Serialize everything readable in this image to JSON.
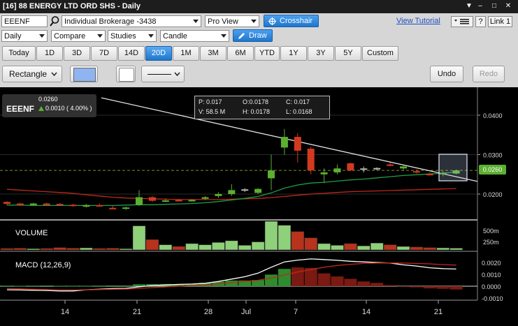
{
  "window": {
    "title": "[16] 88 ENERGY LTD ORD SHS - Daily",
    "controls": [
      "▼",
      "–",
      "□",
      "✕"
    ]
  },
  "toolbar": {
    "symbol": "EEENF",
    "account": "Individual Brokerage -3438",
    "view": "Pro View",
    "crosshair_label": "Crosshair",
    "view_tutorial": "View Tutorial",
    "help": "?",
    "link": "Link 1",
    "interval": "Daily",
    "compare": "Compare",
    "studies": "Studies",
    "chart_type": "Candle",
    "draw_label": "Draw"
  },
  "periods": [
    "Today",
    "1D",
    "3D",
    "7D",
    "14D",
    "20D",
    "1M",
    "3M",
    "6M",
    "YTD",
    "1Y",
    "3Y",
    "5Y",
    "Custom"
  ],
  "active_period": "20D",
  "drawing": {
    "shape": "Rectangle",
    "undo": "Undo",
    "redo": "Redo",
    "stroke_color": "#8fb4f0",
    "fill_color": "#ffffff"
  },
  "quote": {
    "symbol": "EEENF",
    "last": "0.0260",
    "change": "0.0010 ( 4.00% )"
  },
  "ohlc_box": {
    "p": "P: 0.017",
    "o": "O:0.0178",
    "c": "C: 0.017",
    "v": "V: 58.5 M",
    "h": "H: 0.0178",
    "l": "L: 0.0168"
  },
  "price_axis": {
    "ticks": [
      "0.0400",
      "0.0300",
      "0.0200"
    ],
    "current": "0.0260"
  },
  "volume": {
    "label": "VOLUME",
    "ticks": [
      "500m",
      "250m"
    ]
  },
  "macd": {
    "label": "MACD (12,26,9)",
    "ticks": [
      "0.0020",
      "0.0010",
      "0.0000",
      "-0.0010"
    ]
  },
  "x_axis": [
    "14",
    "21",
    "28",
    "Jul",
    "7",
    "14",
    "21"
  ],
  "colors": {
    "up": "#5cb030",
    "down": "#d23a1f",
    "volume_up": "#8fd07a",
    "volume_down": "#b8321c",
    "accent": "#1f76cc"
  },
  "chart_data": {
    "type": "candlestick",
    "candles": [
      {
        "o": 0.018,
        "h": 0.0182,
        "l": 0.0172,
        "c": 0.0175,
        "dir": "down",
        "vol": 25
      },
      {
        "o": 0.0176,
        "h": 0.0178,
        "l": 0.017,
        "c": 0.0172,
        "dir": "down",
        "vol": 30
      },
      {
        "o": 0.0172,
        "h": 0.0178,
        "l": 0.017,
        "c": 0.0176,
        "dir": "up",
        "vol": 20
      },
      {
        "o": 0.0176,
        "h": 0.0178,
        "l": 0.017,
        "c": 0.0172,
        "dir": "down",
        "vol": 25
      },
      {
        "o": 0.0175,
        "h": 0.0177,
        "l": 0.017,
        "c": 0.0173,
        "dir": "down",
        "vol": 40
      },
      {
        "o": 0.0173,
        "h": 0.0175,
        "l": 0.0168,
        "c": 0.017,
        "dir": "down",
        "vol": 30
      },
      {
        "o": 0.0168,
        "h": 0.0175,
        "l": 0.0166,
        "c": 0.0172,
        "dir": "up",
        "vol": 35
      },
      {
        "o": 0.0172,
        "h": 0.0176,
        "l": 0.0168,
        "c": 0.017,
        "dir": "down",
        "vol": 25
      },
      {
        "o": 0.0165,
        "h": 0.017,
        "l": 0.0162,
        "c": 0.0163,
        "dir": "down",
        "vol": 30
      },
      {
        "o": 0.0163,
        "h": 0.0168,
        "l": 0.016,
        "c": 0.0166,
        "dir": "up",
        "vol": 20
      },
      {
        "o": 0.0172,
        "h": 0.021,
        "l": 0.017,
        "c": 0.0192,
        "dir": "up",
        "vol": 420
      },
      {
        "o": 0.0192,
        "h": 0.0195,
        "l": 0.018,
        "c": 0.0183,
        "dir": "down",
        "vol": 180
      },
      {
        "o": 0.0182,
        "h": 0.0188,
        "l": 0.018,
        "c": 0.0184,
        "dir": "up",
        "vol": 90
      },
      {
        "o": 0.0185,
        "h": 0.0188,
        "l": 0.0181,
        "c": 0.0183,
        "dir": "down",
        "vol": 60
      },
      {
        "o": 0.0183,
        "h": 0.0187,
        "l": 0.0181,
        "c": 0.0185,
        "dir": "up",
        "vol": 110
      },
      {
        "o": 0.0188,
        "h": 0.0195,
        "l": 0.0185,
        "c": 0.0192,
        "dir": "up",
        "vol": 90
      },
      {
        "o": 0.0195,
        "h": 0.0205,
        "l": 0.019,
        "c": 0.02,
        "dir": "up",
        "vol": 130
      },
      {
        "o": 0.02,
        "h": 0.0225,
        "l": 0.0195,
        "c": 0.021,
        "dir": "up",
        "vol": 160
      },
      {
        "o": 0.021,
        "h": 0.0215,
        "l": 0.0205,
        "c": 0.0212,
        "dir": "neutral",
        "vol": 80
      },
      {
        "o": 0.0203,
        "h": 0.0215,
        "l": 0.02,
        "c": 0.0213,
        "dir": "up",
        "vol": 140
      },
      {
        "o": 0.026,
        "h": 0.03,
        "l": 0.021,
        "c": 0.024,
        "dir": "up",
        "vol": 500
      },
      {
        "o": 0.0318,
        "h": 0.0365,
        "l": 0.03,
        "c": 0.0345,
        "dir": "up",
        "vol": 430
      },
      {
        "o": 0.0345,
        "h": 0.0355,
        "l": 0.028,
        "c": 0.031,
        "dir": "down",
        "vol": 320
      },
      {
        "o": 0.0315,
        "h": 0.032,
        "l": 0.025,
        "c": 0.026,
        "dir": "down",
        "vol": 210
      },
      {
        "o": 0.0255,
        "h": 0.0265,
        "l": 0.0228,
        "c": 0.025,
        "dir": "up",
        "vol": 110
      },
      {
        "o": 0.0255,
        "h": 0.0275,
        "l": 0.025,
        "c": 0.0265,
        "dir": "up",
        "vol": 80
      },
      {
        "o": 0.0278,
        "h": 0.028,
        "l": 0.0258,
        "c": 0.026,
        "dir": "down",
        "vol": 110
      },
      {
        "o": 0.0262,
        "h": 0.027,
        "l": 0.0255,
        "c": 0.0265,
        "dir": "neutral",
        "vol": 70
      },
      {
        "o": 0.0266,
        "h": 0.0268,
        "l": 0.026,
        "c": 0.0264,
        "dir": "neutral",
        "vol": 120
      },
      {
        "o": 0.0275,
        "h": 0.028,
        "l": 0.027,
        "c": 0.0272,
        "dir": "down",
        "vol": 90
      },
      {
        "o": 0.0265,
        "h": 0.0272,
        "l": 0.026,
        "c": 0.027,
        "dir": "up",
        "vol": 60
      },
      {
        "o": 0.0258,
        "h": 0.0262,
        "l": 0.0252,
        "c": 0.0255,
        "dir": "down",
        "vol": 50
      },
      {
        "o": 0.0251,
        "h": 0.0255,
        "l": 0.0248,
        "c": 0.025,
        "dir": "down",
        "vol": 40
      },
      {
        "o": 0.025,
        "h": 0.0258,
        "l": 0.0245,
        "c": 0.0254,
        "dir": "up",
        "vol": 35
      },
      {
        "o": 0.0252,
        "h": 0.0262,
        "l": 0.025,
        "c": 0.026,
        "dir": "up",
        "vol": 30
      }
    ],
    "red_ma": [
      0.0212,
      0.021,
      0.0208,
      0.0206,
      0.0204,
      0.0202,
      0.0198,
      0.0195,
      0.0192,
      0.019,
      0.0189,
      0.0188,
      0.0187,
      0.0186,
      0.0186,
      0.0186,
      0.0186,
      0.0187,
      0.0188,
      0.0189,
      0.0191,
      0.0194,
      0.0197,
      0.02,
      0.0202,
      0.0204,
      0.0206,
      0.0207,
      0.0208,
      0.0209,
      0.021,
      0.0211,
      0.0212,
      0.0213,
      0.0214
    ],
    "green_ma": [
      0.0172,
      0.0172,
      0.0171,
      0.0171,
      0.0171,
      0.0171,
      0.0171,
      0.0171,
      0.0171,
      0.0172,
      0.0173,
      0.0173,
      0.0174,
      0.0175,
      0.0176,
      0.0178,
      0.0181,
      0.0185,
      0.0189,
      0.0194,
      0.0203,
      0.0215,
      0.0223,
      0.0228,
      0.023,
      0.0233,
      0.0236,
      0.0238,
      0.0241,
      0.0244,
      0.0247,
      0.0249,
      0.0251,
      0.0253,
      0.0256
    ],
    "trendline": {
      "start_price": 0.0444,
      "end_price": 0.0232
    },
    "macd_hist": [
      5e-05,
      4e-05,
      5e-05,
      6e-05,
      4e-05,
      2e-05,
      2e-05,
      1e-05,
      0.0,
      0.0,
      0.00016,
      0.00018,
      0.00019,
      0.00018,
      0.0002,
      0.00028,
      0.00038,
      0.00048,
      0.00048,
      0.00052,
      0.00098,
      0.00146,
      0.00158,
      0.00154,
      0.00108,
      0.00082,
      0.00062,
      0.0004,
      0.00028,
      0.0001,
      -2e-05,
      -0.0001,
      -0.00018,
      -0.00022,
      -0.00028
    ],
    "macd_line": [
      -0.0003,
      -0.00032,
      -0.00034,
      -0.00036,
      -0.0004,
      -0.0004,
      -0.0003,
      -0.00025,
      -0.0002,
      -0.00018,
      -5e-05,
      5e-05,
      0.0001,
      0.00015,
      0.00018,
      0.00025,
      0.0004,
      0.0006,
      0.0008,
      0.0011,
      0.0016,
      0.00205,
      0.0022,
      0.0023,
      0.00225,
      0.00218,
      0.0021,
      0.00205,
      0.002,
      0.00195,
      0.0018,
      0.0017,
      0.00155,
      0.00148,
      0.00145
    ],
    "signal_line": [
      -0.0002,
      -0.00022,
      -0.00025,
      -0.00028,
      -0.0003,
      -0.00032,
      -0.0003,
      -0.00028,
      -0.00026,
      -0.00024,
      -0.00018,
      -0.00012,
      -6e-05,
      0.0,
      6e-05,
      0.0001,
      0.0002,
      0.0003,
      0.0004,
      0.0005,
      0.0007,
      0.00095,
      0.0012,
      0.0014,
      0.0016,
      0.00175,
      0.00185,
      0.00192,
      0.00195,
      0.00196,
      0.00195,
      0.00192,
      0.00188,
      0.00182,
      0.00178
    ]
  }
}
